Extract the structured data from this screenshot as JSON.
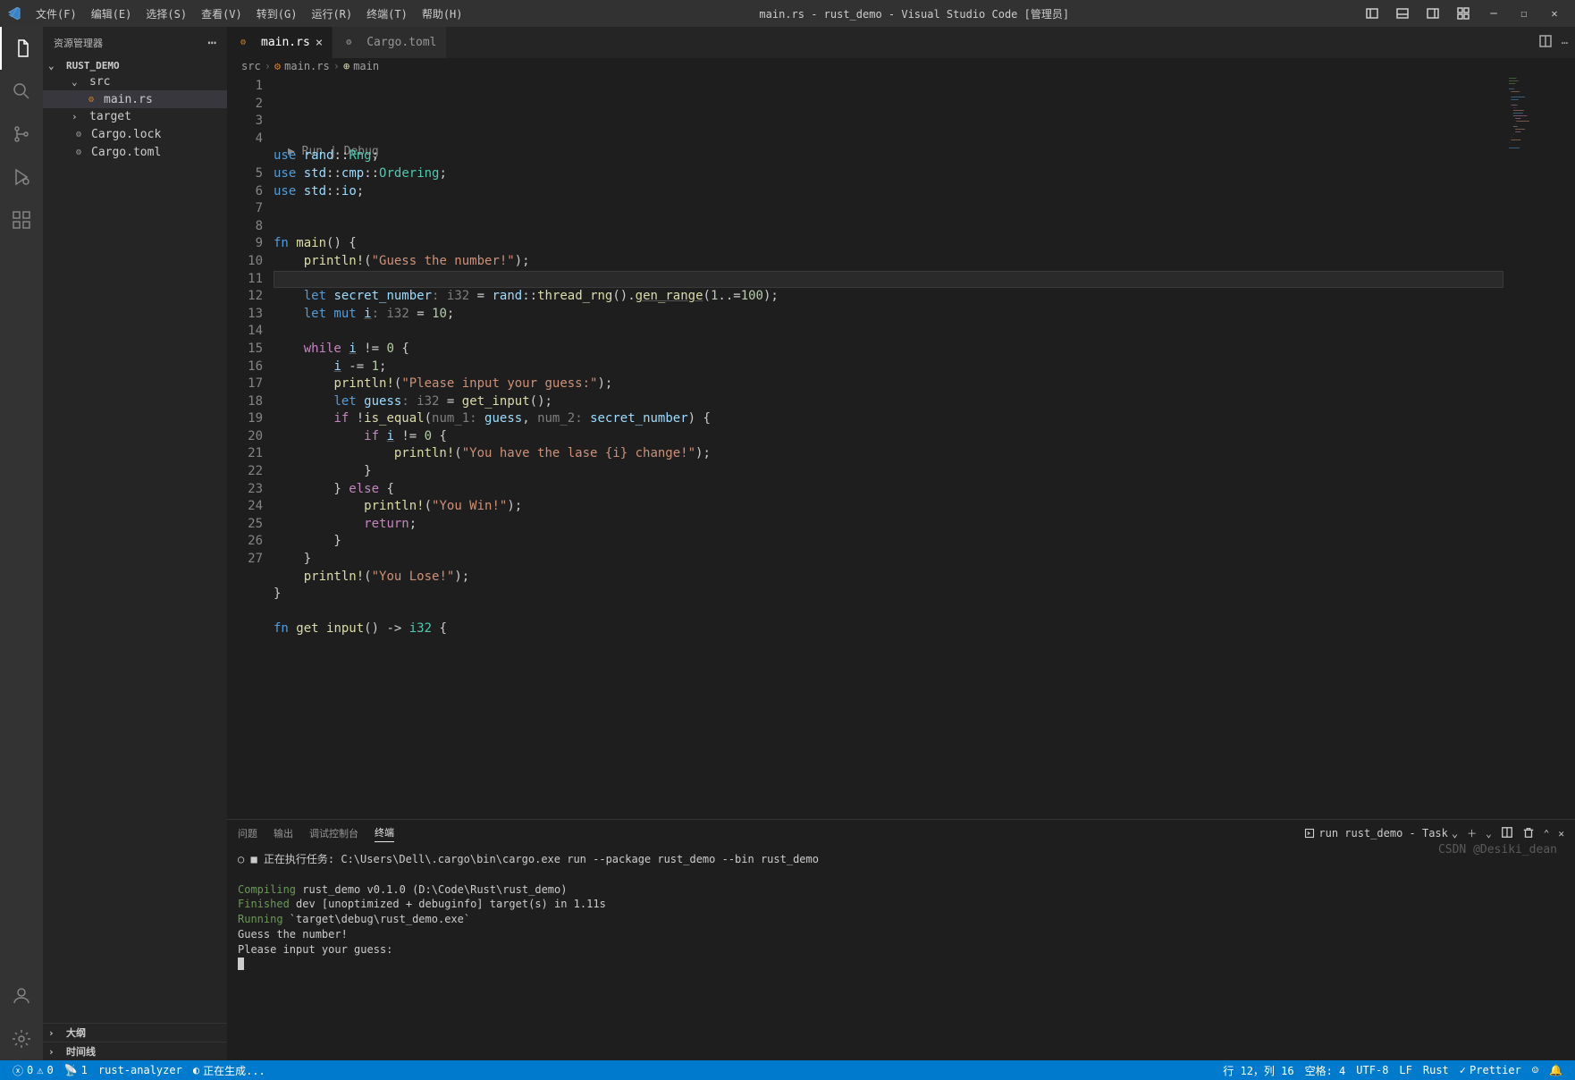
{
  "title": "main.rs - rust_demo - Visual Studio Code [管理员]",
  "menu": [
    "文件(F)",
    "编辑(E)",
    "选择(S)",
    "查看(V)",
    "转到(G)",
    "运行(R)",
    "终端(T)",
    "帮助(H)"
  ],
  "sidebar": {
    "header": "资源管理器",
    "project": "RUST_DEMO",
    "tree": {
      "src": "src",
      "mainrs": "main.rs",
      "target": "target",
      "cargolock": "Cargo.lock",
      "cargotoml": "Cargo.toml"
    },
    "outline": "大纲",
    "timeline": "时间线"
  },
  "tabs": {
    "main": "main.rs",
    "cargo": "Cargo.toml"
  },
  "breadcrumbs": [
    "src",
    "main.rs",
    "main"
  ],
  "codelens": "▶ Run | Debug",
  "code_lines": [
    "1",
    "2",
    "3",
    "4",
    "5",
    "6",
    "7",
    "8",
    "9",
    "10",
    "11",
    "12",
    "13",
    "14",
    "15",
    "16",
    "17",
    "18",
    "19",
    "20",
    "21",
    "22",
    "23",
    "24",
    "25",
    "26",
    "27"
  ],
  "panel": {
    "tabs": [
      "问题",
      "输出",
      "调试控制台",
      "终端"
    ],
    "task_label": "run rust_demo - Task",
    "running": "正在执行任务: C:\\Users\\Dell\\.cargo\\bin\\cargo.exe run --package rust_demo --bin rust_demo",
    "compile": "Compiling",
    "compile_rest": " rust_demo v0.1.0 (D:\\Code\\Rust\\rust_demo)",
    "finished": "Finished",
    "finished_rest": " dev [unoptimized + debuginfo] target(s) in 1.11s",
    "running_lbl": "Running",
    "running_rest": " `target\\debug\\rust_demo.exe`",
    "out1": "Guess the number!",
    "out2": "Please input your guess:"
  },
  "status": {
    "errors": "0",
    "warnings": "0",
    "ports": "1",
    "analyzer": "rust-analyzer",
    "building": "正在生成...",
    "pos": "行 12，列 16",
    "spaces": "空格: 4",
    "enc": "UTF-8",
    "eol": "LF",
    "lang": "Rust",
    "prettier": "Prettier"
  },
  "watermark": "CSDN @Desiki_dean"
}
